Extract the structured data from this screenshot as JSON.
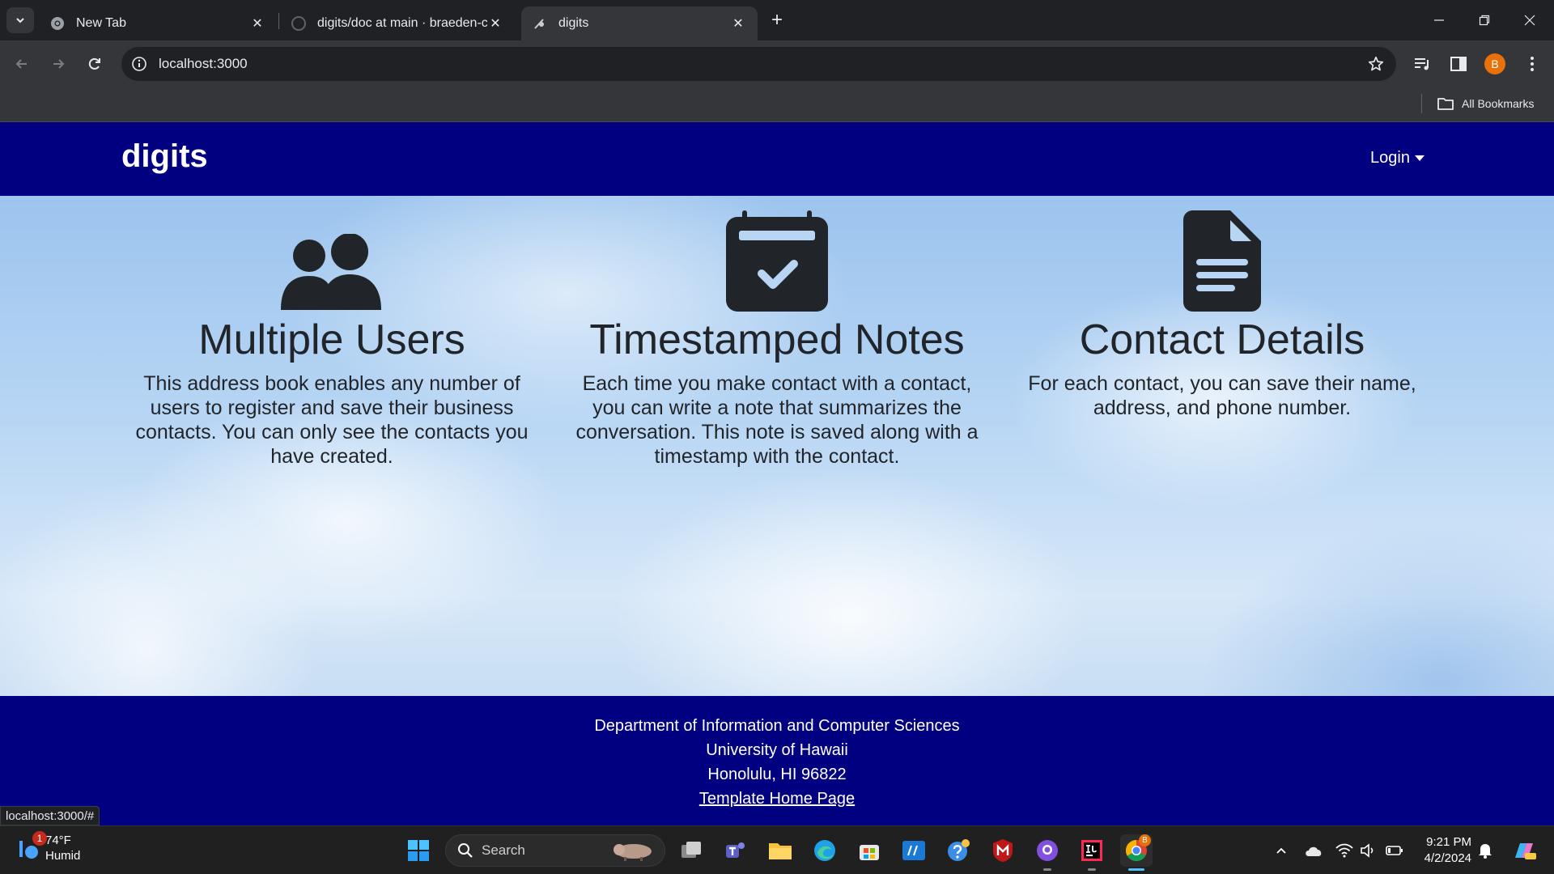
{
  "browser": {
    "tabs": [
      {
        "label": "New Tab"
      },
      {
        "label": "digits/doc at main · braeden-cs"
      },
      {
        "label": "digits"
      }
    ],
    "url": "localhost:3000",
    "bookmarks_label": "All Bookmarks",
    "profile_initial": "B",
    "status_url": "localhost:3000/#"
  },
  "site": {
    "brand": "digits",
    "login_label": "Login",
    "features": [
      {
        "icon": "users-icon",
        "title": "Multiple Users",
        "text": "This address book enables any number of users to register and save their business contacts. You can only see the contacts you have created."
      },
      {
        "icon": "calendar-check-icon",
        "title": "Timestamped Notes",
        "text": "Each time you make contact with a contact, you can write a note that summarizes the conversation. This note is saved along with a timestamp with the contact."
      },
      {
        "icon": "file-icon",
        "title": "Contact Details",
        "text": "For each contact, you can save their name, address, and phone number."
      }
    ],
    "footer": {
      "line1": "Department of Information and Computer Sciences",
      "line2": "University of Hawaii",
      "line3": "Honolulu, HI 96822",
      "link": "Template Home Page"
    }
  },
  "taskbar": {
    "weather_temp": "74°F",
    "weather_desc": "Humid",
    "weather_badge": "1",
    "search_label": "Search",
    "chrome_badge": "B",
    "time": "9:21 PM",
    "date": "4/2/2024"
  },
  "colors": {
    "navbar": "#000080",
    "footer": "#000080",
    "text_dark": "#212529",
    "chrome_dark": "#202124",
    "chrome_mid": "#35363a"
  }
}
